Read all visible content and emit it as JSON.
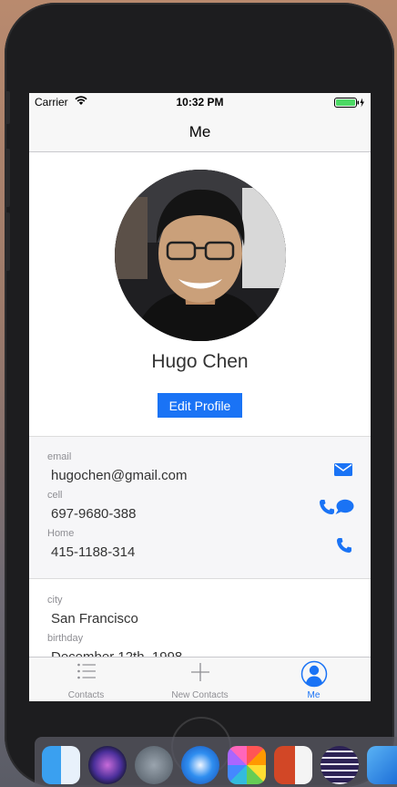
{
  "status_bar": {
    "carrier": "Carrier",
    "time": "10:32 PM"
  },
  "nav": {
    "title": "Me"
  },
  "profile": {
    "name": "Hugo Chen",
    "edit_label": "Edit Profile"
  },
  "contact": {
    "email_label": "email",
    "email_value": "hugochen@gmail.com",
    "cell_label": "cell",
    "cell_value": "697-9680-388",
    "home_label": "Home",
    "home_value": "415-1188-314"
  },
  "details": {
    "city_label": "city",
    "city_value": "San Francisco",
    "birthday_label": "birthday",
    "birthday_value": "December 12th, 1998"
  },
  "tabs": [
    {
      "label": "Contacts"
    },
    {
      "label": "New Contacts"
    },
    {
      "label": "Me"
    }
  ],
  "colors": {
    "accent": "#1a73f5",
    "tab_inactive": "#8e8e93"
  },
  "dock_icons": [
    "finder-icon",
    "siri-icon",
    "launchpad-icon",
    "safari-icon",
    "photos-icon",
    "powerpoint-icon",
    "eclipse-icon",
    "xcode-icon"
  ]
}
